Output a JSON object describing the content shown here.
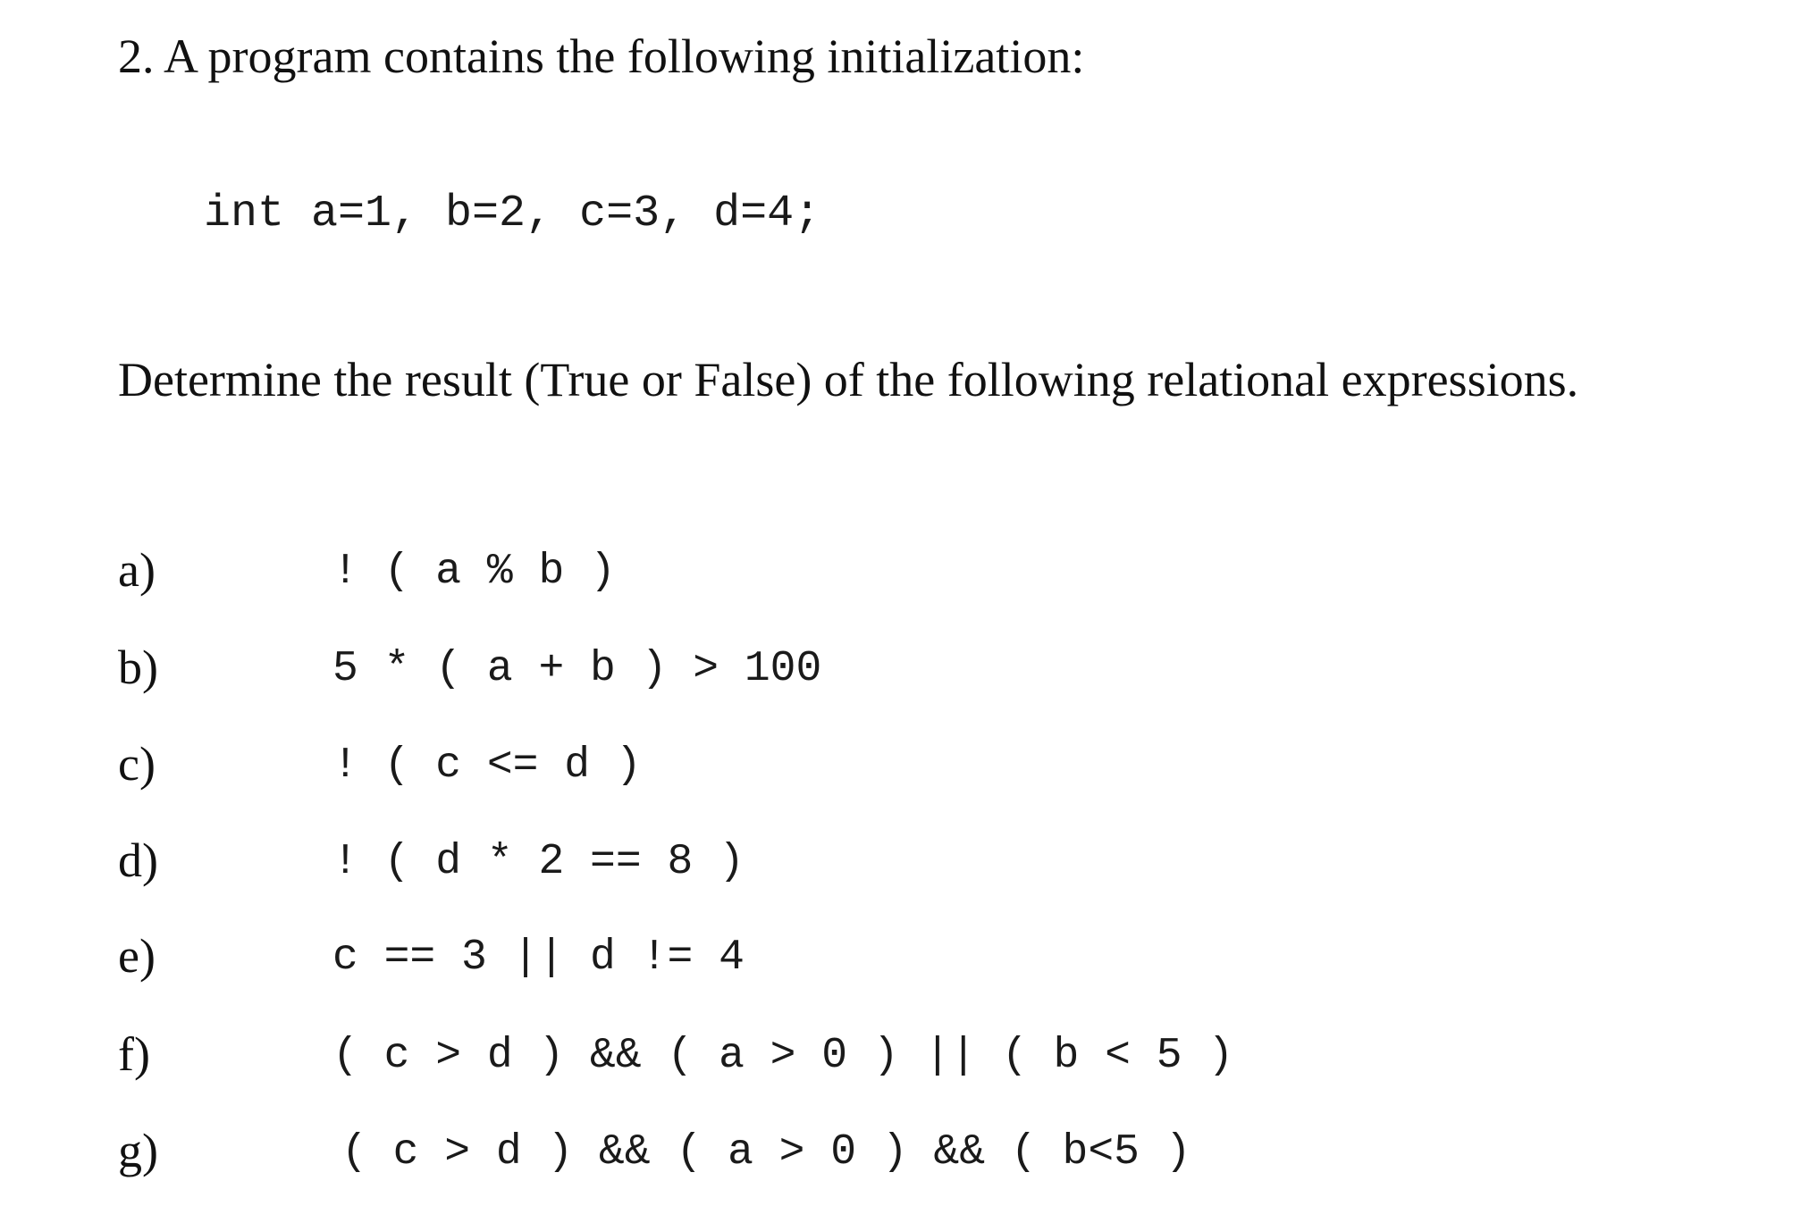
{
  "problem": {
    "title": "2. A program contains the following initialization:",
    "code": "int a=1, b=2, c=3, d=4;",
    "instruction": "Determine the result (True or False) of the following relational expressions."
  },
  "questions": [
    {
      "label": "a)",
      "expression": "! ( a % b )"
    },
    {
      "label": "b)",
      "expression": "5 * ( a + b ) > 100"
    },
    {
      "label": "c)",
      "expression": "! ( c <= d )"
    },
    {
      "label": "d)",
      "expression": "! ( d * 2 == 8 )"
    },
    {
      "label": "e)",
      "expression": "c == 3 || d != 4"
    },
    {
      "label": "f)",
      "expression": "( c > d ) && ( a > 0 ) || ( b < 5 )"
    },
    {
      "label": "g)",
      "expression": "( c > d ) && ( a > 0 ) && ( b<5 )"
    }
  ]
}
